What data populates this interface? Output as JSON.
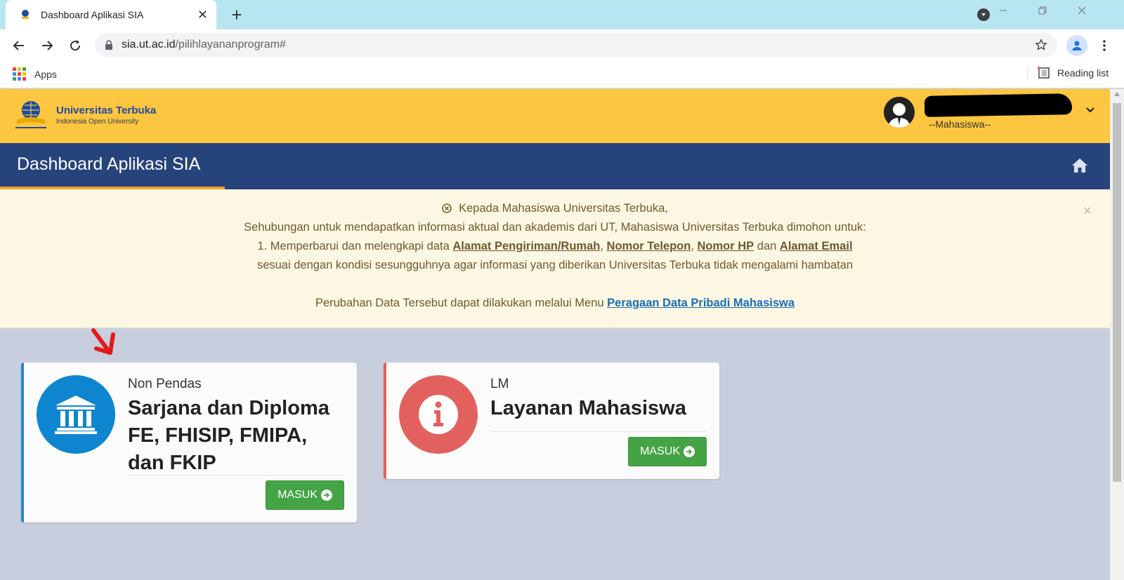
{
  "browser": {
    "tab_title": "Dashboard Aplikasi SIA",
    "tab_close": "✕",
    "new_tab": "+",
    "url_host": "sia.ut.ac.id",
    "url_path": "/pilihlayananprogram#",
    "bookmarks": {
      "apps_label": "Apps",
      "reading_list_label": "Reading list"
    }
  },
  "header": {
    "logo_name": "Universitas Terbuka",
    "logo_subtitle": "Indonesia Open University",
    "user_role": "--Mahasiswa--"
  },
  "titlebar": {
    "title": "Dashboard Aplikasi SIA"
  },
  "alert": {
    "greeting": "Kepada Mahasiswa Universitas Terbuka,",
    "intro": "Sehubungan untuk mendapatkan informasi aktual dan akademis dari UT, Mahasiswa Universitas Terbuka dimohon untuk:",
    "item_prefix": "1. Memperbarui dan melengkapi data",
    "link_address": "Alamat Pengiriman/Rumah",
    "sep1": ",",
    "link_phone": "Nomor Telepon",
    "sep2": ",",
    "link_hp": "Nomor HP",
    "and": "dan",
    "link_email": "Alamat Email",
    "condition": "sesuai dengan kondisi sesungguhnya agar informasi yang diberikan Universitas Terbuka tidak mengalami hambatan",
    "change_prefix": "Perubahan Data Tersebut dapat dilakukan melalui Menu",
    "change_link": "Peragaan Data Pribadi Mahasiswa",
    "close": "×"
  },
  "cards": [
    {
      "kicker": "Non Pendas",
      "headline": "Sarjana dan Diploma FE, FHISIP, FMIPA, dan FKIP",
      "button": "MASUK",
      "icon": "bank-icon",
      "color": "#0d86cf"
    },
    {
      "kicker": "LM",
      "headline": "Layanan Mahasiswa",
      "button": "MASUK",
      "icon": "info-icon",
      "color": "#e2615e"
    }
  ],
  "colors": {
    "topbar": "#fdc640",
    "titlebar": "#27437c",
    "accent": "#f6a22b",
    "button": "#44a344",
    "page_bg": "#c8cedd"
  }
}
